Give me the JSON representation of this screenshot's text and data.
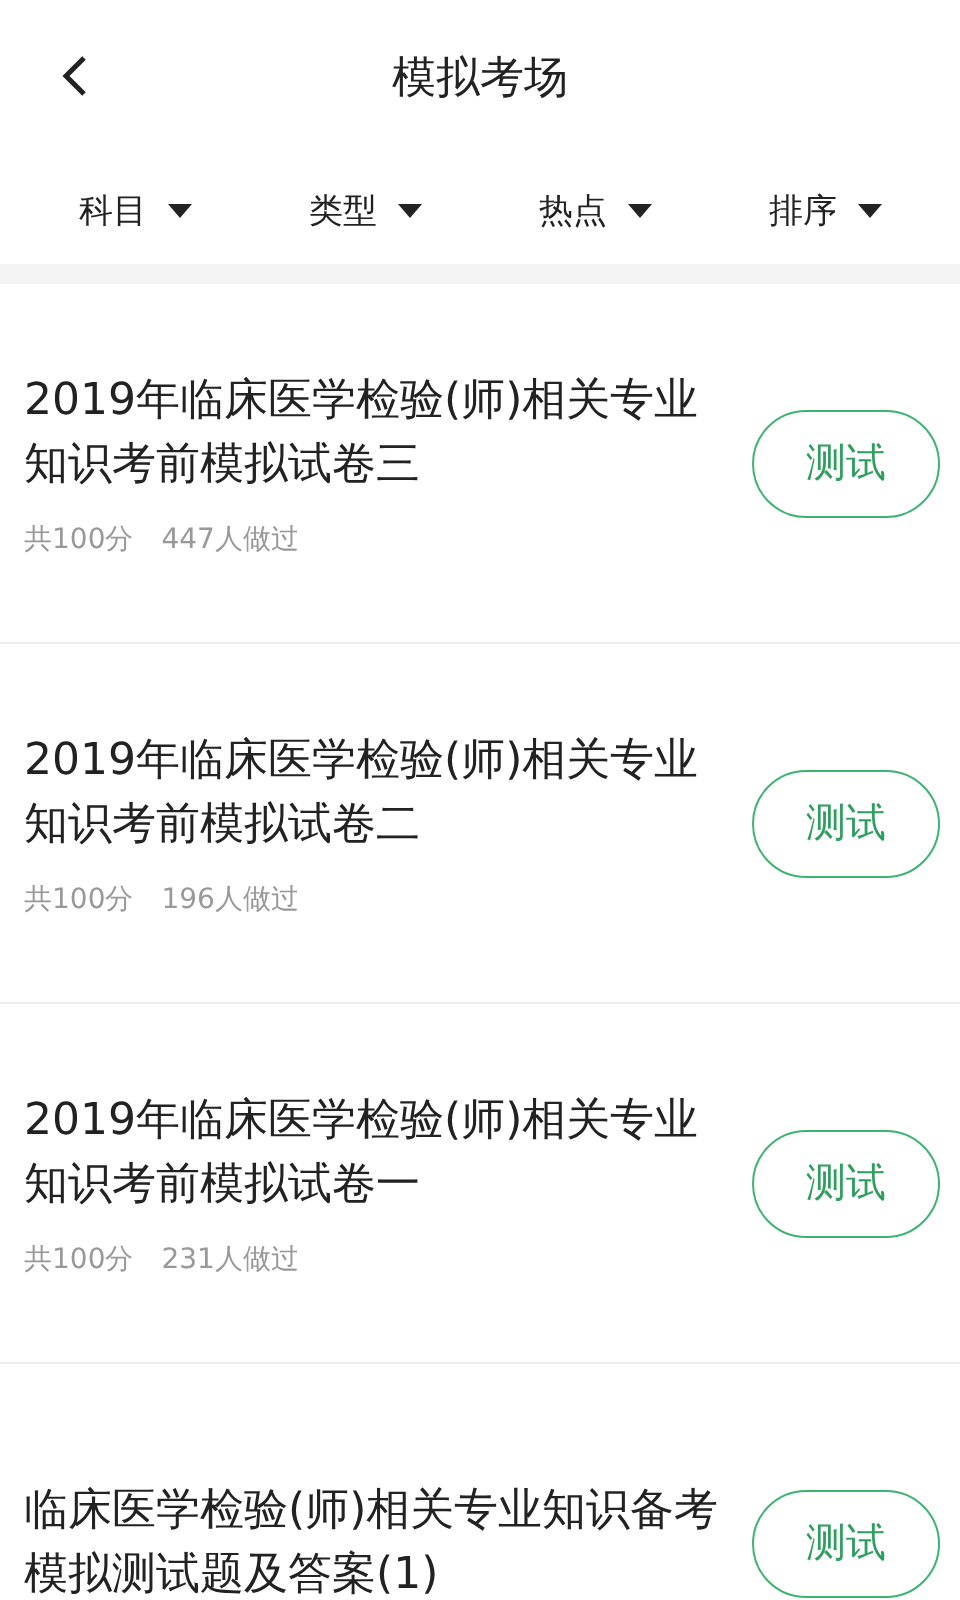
{
  "header": {
    "title": "模拟考场"
  },
  "filters": [
    {
      "label": "科目"
    },
    {
      "label": "类型"
    },
    {
      "label": "热点"
    },
    {
      "label": "排序"
    }
  ],
  "papers": [
    {
      "title": "2019年临床医学检验(师)相关专业知识考前模拟试卷三",
      "total": "共100分",
      "takers": "447人做过",
      "button": "测试"
    },
    {
      "title": "2019年临床医学检验(师)相关专业知识考前模拟试卷二",
      "total": "共100分",
      "takers": "196人做过",
      "button": "测试"
    },
    {
      "title": "2019年临床医学检验(师)相关专业知识考前模拟试卷一",
      "total": "共100分",
      "takers": "231人做过",
      "button": "测试"
    },
    {
      "title": "临床医学检验(师)相关专业知识备考模拟测试题及答案(1)",
      "button": "测试"
    }
  ]
}
